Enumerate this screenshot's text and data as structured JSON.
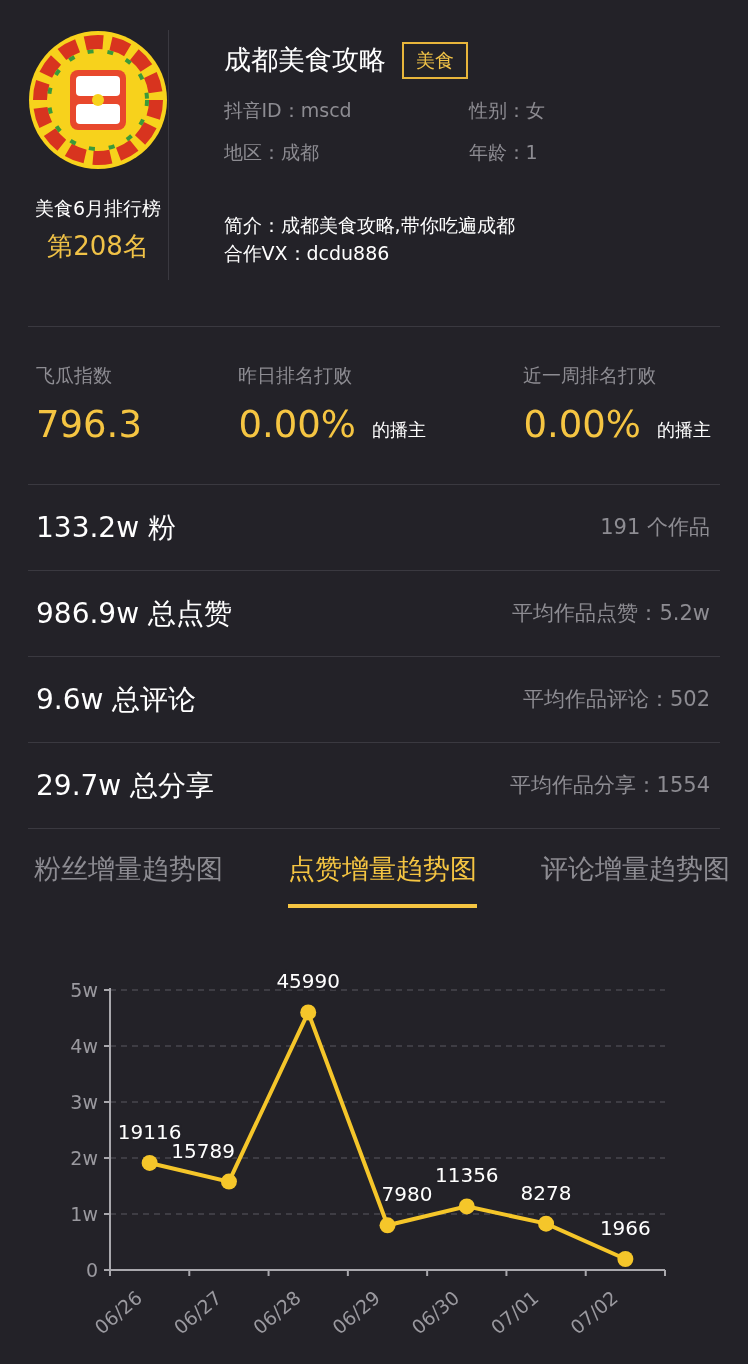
{
  "profile": {
    "rank_title": "美食6月排行榜",
    "rank": "第208名",
    "name": "成都美食攻略",
    "tag": "美食",
    "fields": [
      {
        "text": "抖音ID：mscd"
      },
      {
        "text": "性别：女"
      },
      {
        "text": "地区：成都"
      },
      {
        "text": "年龄：1"
      }
    ],
    "bio": "简介：成都美食攻略,带你吃遍成都",
    "contact": "合作VX：dcdu886"
  },
  "indices": [
    {
      "label": "飞瓜指数",
      "value": "796.3"
    },
    {
      "label": "昨日排名打败",
      "value": "0.00%",
      "suffix": "的播主"
    },
    {
      "label": "近一周排名打败",
      "value": "0.00%",
      "suffix": "的播主"
    }
  ],
  "stats": [
    {
      "main": "133.2w 粉",
      "side": "191 个作品"
    },
    {
      "main": "986.9w 总点赞",
      "side": "平均作品点赞：5.2w"
    },
    {
      "main": "9.6w 总评论",
      "side": "平均作品评论：502"
    },
    {
      "main": "29.7w 总分享",
      "side": "平均作品分享：1554"
    }
  ],
  "tabs": [
    {
      "label": "粉丝增量趋势图",
      "selected": false
    },
    {
      "label": "点赞增量趋势图",
      "selected": true
    },
    {
      "label": "评论增量趋势图",
      "selected": false
    }
  ],
  "chart": {
    "chart_data": {
      "type": "line",
      "categories": [
        "06/26",
        "06/27",
        "06/28",
        "06/29",
        "06/30",
        "07/01",
        "07/02"
      ],
      "grid": true,
      "series": [
        {
          "color": "#f5c62a",
          "marker": "circle",
          "values": [
            1.9116,
            1.5789,
            4.599,
            0.798,
            1.1356,
            0.8278,
            0.1966
          ]
        }
      ],
      "ylim": [
        0,
        5
      ],
      "yticks": [
        {
          "value": 0,
          "label": "0"
        },
        {
          "value": 1,
          "label": "1w"
        },
        {
          "value": 2,
          "label": "2w"
        },
        {
          "value": 3,
          "label": "3w"
        },
        {
          "value": 4,
          "label": "4w"
        },
        {
          "value": 5,
          "label": "5w"
        }
      ],
      "value_labels": [
        "19116",
        "15789",
        "45990",
        "7980",
        "11356",
        "8278",
        "1966"
      ]
    }
  }
}
